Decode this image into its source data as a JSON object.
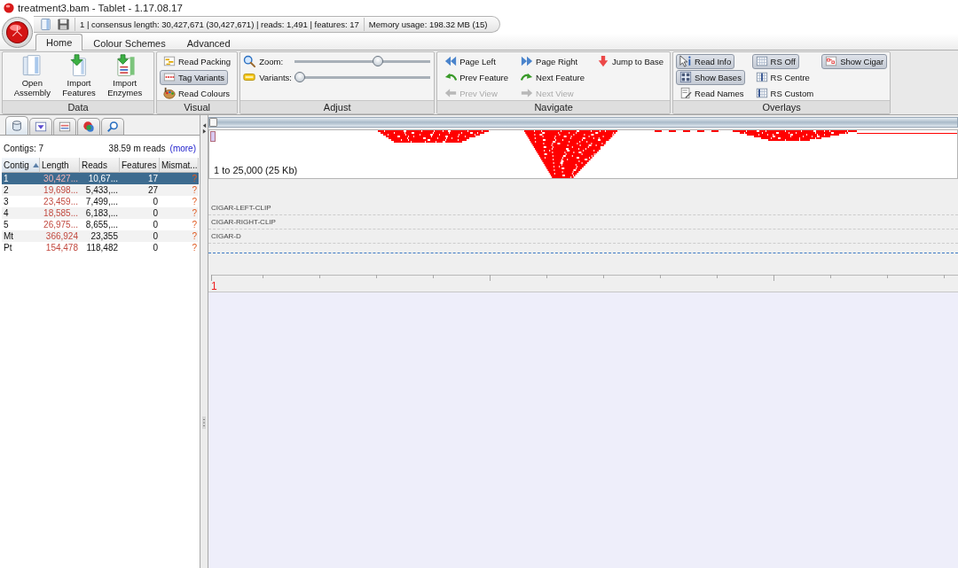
{
  "window": {
    "title": "treatment3.bam - Tablet - 1.17.08.17"
  },
  "quick_access": {
    "status": "1 | consensus length: 30,427,671 (30,427,671) | reads: 1,491 | features: 17",
    "memory": "Memory usage: 198.32 MB (15)"
  },
  "tabs": [
    {
      "label": "Home",
      "selected": true
    },
    {
      "label": "Colour Schemes",
      "selected": false
    },
    {
      "label": "Advanced",
      "selected": false
    }
  ],
  "ribbon": {
    "groups": [
      {
        "label": "Data",
        "kind": "large",
        "items": [
          {
            "label": "Open Assembly"
          },
          {
            "label": "Import Features"
          },
          {
            "label": "Import Enzymes"
          }
        ]
      },
      {
        "label": "Visual",
        "kind": "toggles",
        "items": [
          {
            "label": "Read Packing",
            "on": false
          },
          {
            "label": "Tag Variants",
            "on": true
          },
          {
            "label": "Read Colours",
            "on": false
          }
        ]
      },
      {
        "label": "Adjust",
        "kind": "sliders",
        "items": [
          {
            "label": "Zoom:",
            "level": 0.62
          },
          {
            "label": "Variants:",
            "level": 0
          }
        ]
      },
      {
        "label": "Navigate",
        "kind": "commands",
        "items": [
          {
            "label": "Page Left",
            "disabled": false
          },
          {
            "label": "Prev Feature",
            "disabled": false
          },
          {
            "label": "Prev View",
            "disabled": true
          },
          {
            "label": "Page Right",
            "disabled": false
          },
          {
            "label": "Next Feature",
            "disabled": false
          },
          {
            "label": "Next View",
            "disabled": true
          },
          {
            "label": "Jump to Base",
            "disabled": false
          }
        ]
      },
      {
        "label": "Overlays",
        "kind": "toggles",
        "items": [
          {
            "label": "Read Info",
            "on": true
          },
          {
            "label": "Show Bases",
            "on": true
          },
          {
            "label": "Read Names",
            "on": false
          },
          {
            "label": "RS Off",
            "on": true
          },
          {
            "label": "RS Centre",
            "on": false
          },
          {
            "label": "RS Custom",
            "on": false
          },
          {
            "label": "Show Cigar",
            "on": true
          }
        ]
      }
    ]
  },
  "contigs_panel": {
    "tabs": [
      {
        "selected": true
      },
      {
        "selected": false
      },
      {
        "selected": false
      },
      {
        "selected": false
      },
      {
        "selected": false
      }
    ],
    "count": "Contigs: 7",
    "reads": "38.59 m reads",
    "more": "(more)",
    "table": {
      "columns": [
        {
          "label": "Contig",
          "sorted": true
        },
        {
          "label": "Length",
          "sorted": false
        },
        {
          "label": "Reads",
          "sorted": false
        },
        {
          "label": "Features",
          "sorted": false
        },
        {
          "label": "Mismat...",
          "sorted": false
        }
      ],
      "rows": [
        {
          "cells": [
            "1",
            "30,427...",
            "10,67...",
            "17",
            "?"
          ],
          "selected": true
        },
        {
          "cells": [
            "2",
            "19,698...",
            "5,433,...",
            "27",
            "?"
          ],
          "selected": false
        },
        {
          "cells": [
            "3",
            "23,459...",
            "7,499,...",
            "0",
            "?"
          ],
          "selected": false
        },
        {
          "cells": [
            "4",
            "18,585...",
            "6,183,...",
            "0",
            "?"
          ],
          "selected": false
        },
        {
          "cells": [
            "5",
            "26,975...",
            "8,655,...",
            "0",
            "?"
          ],
          "selected": false
        },
        {
          "cells": [
            "Mt",
            "366,924",
            "23,355",
            "0",
            "?"
          ],
          "selected": false
        },
        {
          "cells": [
            "Pt",
            "154,478",
            "118,482",
            "0",
            "?"
          ],
          "selected": false
        }
      ]
    }
  },
  "viewer": {
    "range": "1 to 25,000 (25 Kb)",
    "tracks": [
      {
        "label": "CIGAR-LEFT-CLIP"
      },
      {
        "label": "CIGAR-RIGHT-CLIP"
      },
      {
        "label": "CIGAR-D"
      }
    ],
    "ruler_start": "1"
  }
}
